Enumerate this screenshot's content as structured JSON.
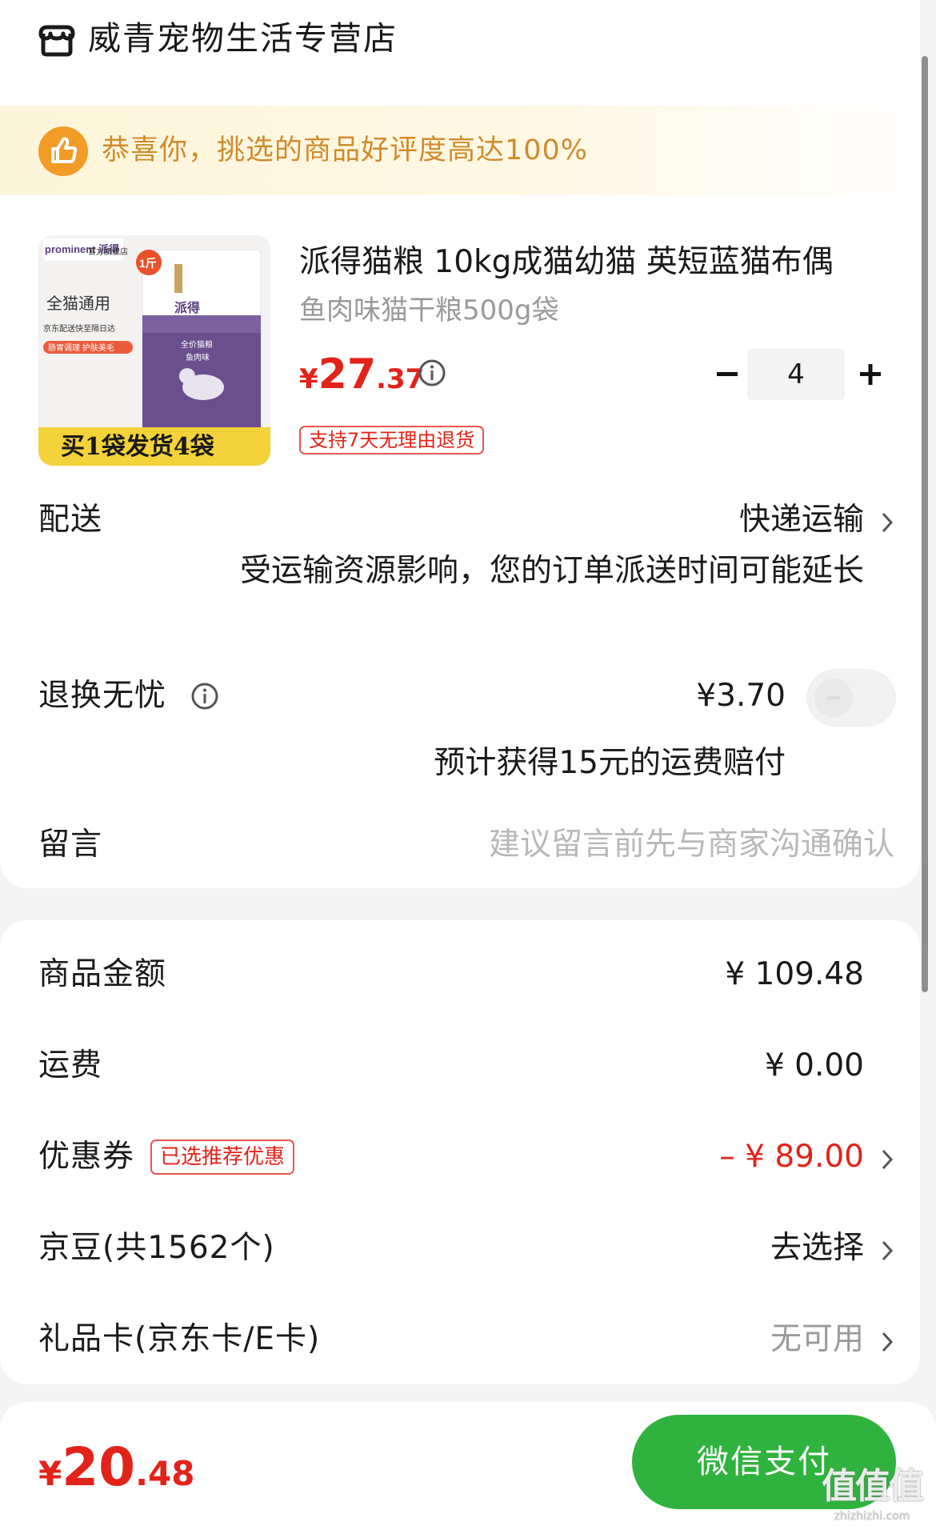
{
  "store": {
    "name": "威青宠物生活专营店"
  },
  "praise": {
    "text": "恭喜你，挑选的商品好评度高达100%"
  },
  "product": {
    "image": {
      "brand": "prominent 派得",
      "store_tag": "官方旗舰店",
      "weight_tag": "1斤",
      "universal": "全猫通用",
      "note": "京东配送快至隔日达",
      "tags": "肠胃调理 护肤美毛",
      "bag_brand": "派得",
      "bag_line1": "全价猫粮",
      "bag_line2": "鱼肉味",
      "promo": "买1袋发货4袋"
    },
    "title": "派得猫粮 10kg成猫幼猫 英短蓝猫布偶",
    "spec": "鱼肉味猫干粮500g袋",
    "price_currency": "¥",
    "price_int": "27",
    "price_dec": ".37",
    "quantity": "4",
    "return_badge": "支持7天无理由退货"
  },
  "delivery": {
    "label": "配送",
    "value": "快递运输",
    "note": "受运输资源影响，您的订单派送时间可能延长"
  },
  "worry_free": {
    "label": "退换无忧",
    "price": "¥3.70",
    "note": "预计获得15元的运费赔付",
    "enabled": false
  },
  "message": {
    "label": "留言",
    "placeholder": "建议留言前先与商家沟通确认"
  },
  "costs": {
    "goods_label": "商品金额",
    "goods_value": "¥ 109.48",
    "shipping_label": "运费",
    "shipping_value": "¥ 0.00",
    "coupon_label": "优惠券",
    "coupon_badge": "已选推荐优惠",
    "coupon_value": "– ¥ 89.00",
    "jd_beans_label": "京豆(共1562个)",
    "jd_beans_value": "去选择",
    "gift_card_label": "礼品卡(京东卡/E卡)",
    "gift_card_value": "无可用"
  },
  "footer": {
    "total_currency": "¥",
    "total_int": "20",
    "total_dec": ".48",
    "pay_label": "微信支付"
  },
  "watermark": {
    "big": "值值值",
    "small": "zhizhizhi.com"
  },
  "colors": {
    "price_red": "#e2231a",
    "pay_green": "#2fb33e",
    "praise_orange": "#f29b27"
  }
}
